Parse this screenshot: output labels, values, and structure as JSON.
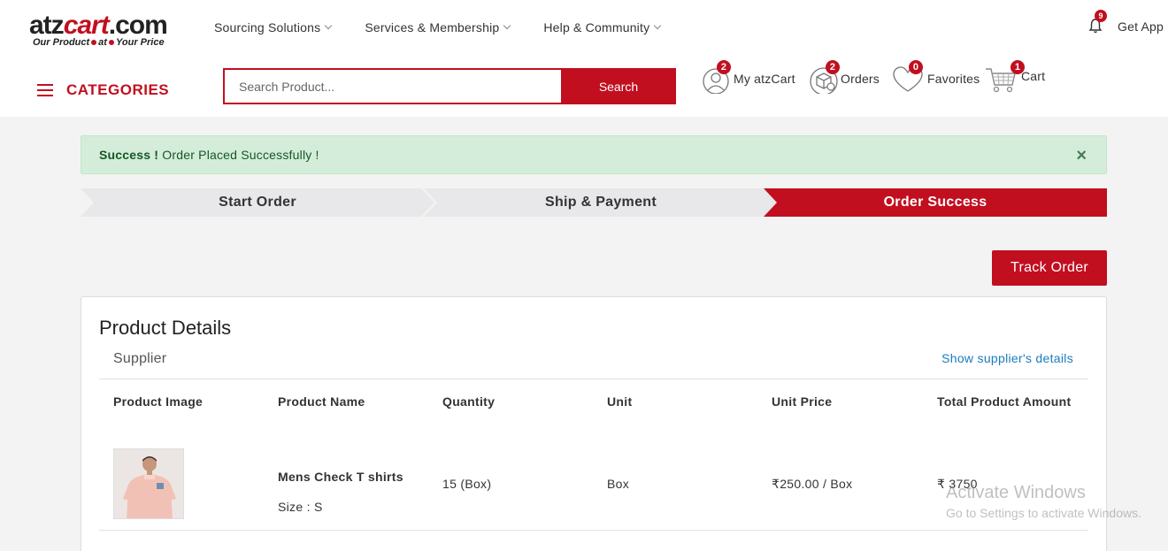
{
  "logo": {
    "brand_black": "atz",
    "brand_red": "cart",
    "brand_suffix": ".com",
    "tag_a": "Our Product",
    "tag_b": "at",
    "tag_c": "Your Price"
  },
  "topnav": [
    "Sourcing Solutions",
    "Services & Membership",
    "Help & Community"
  ],
  "notifications": {
    "count": "9"
  },
  "get_app": "Get App",
  "categories_label": "CATEGORIES",
  "search": {
    "placeholder": "Search Product...",
    "button": "Search"
  },
  "header_icons": {
    "my_atzcart": {
      "label": "My atzCart",
      "badge": "2"
    },
    "orders": {
      "label": "Orders",
      "badge": "2"
    },
    "favorites": {
      "label": "Favorites",
      "badge": "0"
    },
    "cart": {
      "label": "Cart",
      "badge": "1"
    }
  },
  "alert": {
    "strong": "Success !",
    "text": " Order Placed Successfully !",
    "close": "×"
  },
  "steps": [
    "Start Order",
    "Ship & Payment",
    "Order Success"
  ],
  "track_order": "Track Order",
  "product_details": {
    "title": "Product Details",
    "supplier": "Supplier",
    "supplier_link": "Show supplier's details",
    "columns": [
      "Product Image",
      "Product Name",
      "Quantity",
      "Unit",
      "Unit Price",
      "Total Product Amount"
    ],
    "row": {
      "name": "Mens Check T shirts",
      "size": "Size : S",
      "quantity": "15 (Box)",
      "unit": "Box",
      "unit_price": "₹250.00 / Box",
      "total": "₹ 3750"
    }
  },
  "watermark": {
    "line1": "Activate Windows",
    "line2": "Go to Settings to activate Windows."
  },
  "colors": {
    "brand": "#c10f1f",
    "success_bg": "#d4edda",
    "success_text": "#155724",
    "link": "#1a7bbf"
  }
}
